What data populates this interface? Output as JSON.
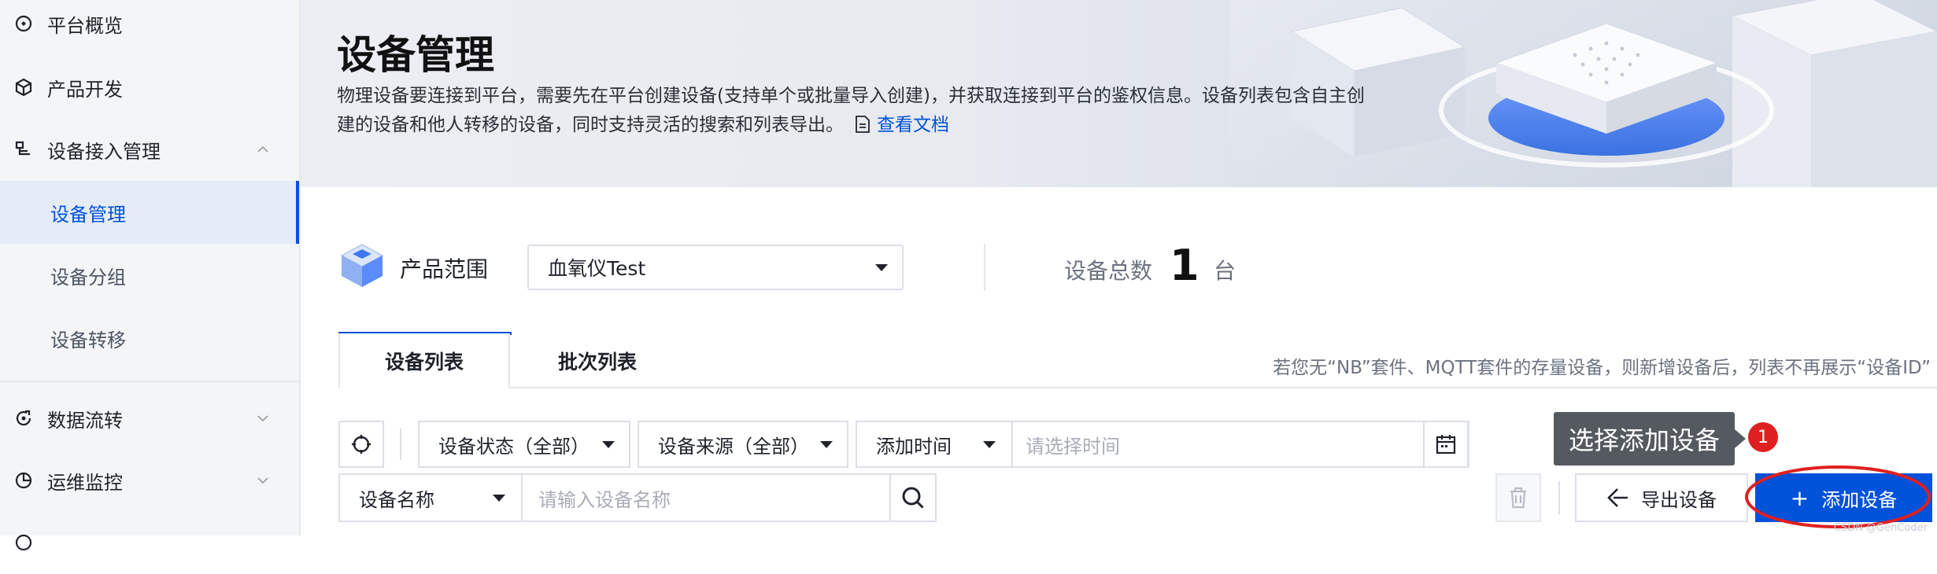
{
  "sidebar": {
    "items": [
      {
        "label": "平台概览",
        "icon": "overview-icon"
      },
      {
        "label": "产品开发",
        "icon": "cube-icon"
      },
      {
        "label": "设备接入管理",
        "icon": "device-access-icon"
      },
      {
        "label": "数据流转",
        "icon": "data-flow-icon"
      },
      {
        "label": "运维监控",
        "icon": "monitor-pie-icon"
      }
    ],
    "sub_items": [
      {
        "label": "设备管理",
        "active": true
      },
      {
        "label": "设备分组"
      },
      {
        "label": "设备转移"
      }
    ]
  },
  "banner": {
    "title": "设备管理",
    "description": "物理设备要连接到平台，需要先在平台创建设备(支持单个或批量导入创建)，并获取连接到平台的鉴权信息。设备列表包含自主创建的设备和他人转移的设备，同时支持灵活的搜索和列表导出。",
    "doc_link": "查看文档"
  },
  "product": {
    "label": "产品范围",
    "selected": "血氧仪Test",
    "total_label": "设备总数",
    "total_count": "1",
    "total_unit": "台"
  },
  "tabs": [
    {
      "label": "设备列表",
      "active": true
    },
    {
      "label": "批次列表"
    }
  ],
  "tabs_note": "若您无“NB”套件、MQTT套件的存量设备，则新增设备后，列表不再展示“设备ID”",
  "filters": {
    "status": "设备状态（全部）",
    "source": "设备来源（全部）",
    "time_type": "添加时间",
    "time_placeholder": "请选择时间",
    "name_type": "设备名称",
    "name_placeholder": "请输入设备名称"
  },
  "actions": {
    "export": "导出设备",
    "add": "添加设备",
    "add_prefix": "+"
  },
  "annotation": {
    "tooltip": "选择添加设备",
    "badge": "1"
  },
  "watermark": "CSDN @GenCoder",
  "colors": {
    "primary": "#0052d9",
    "annotation_red": "#e02020",
    "sidebar_bg": "#f4f5f7"
  }
}
